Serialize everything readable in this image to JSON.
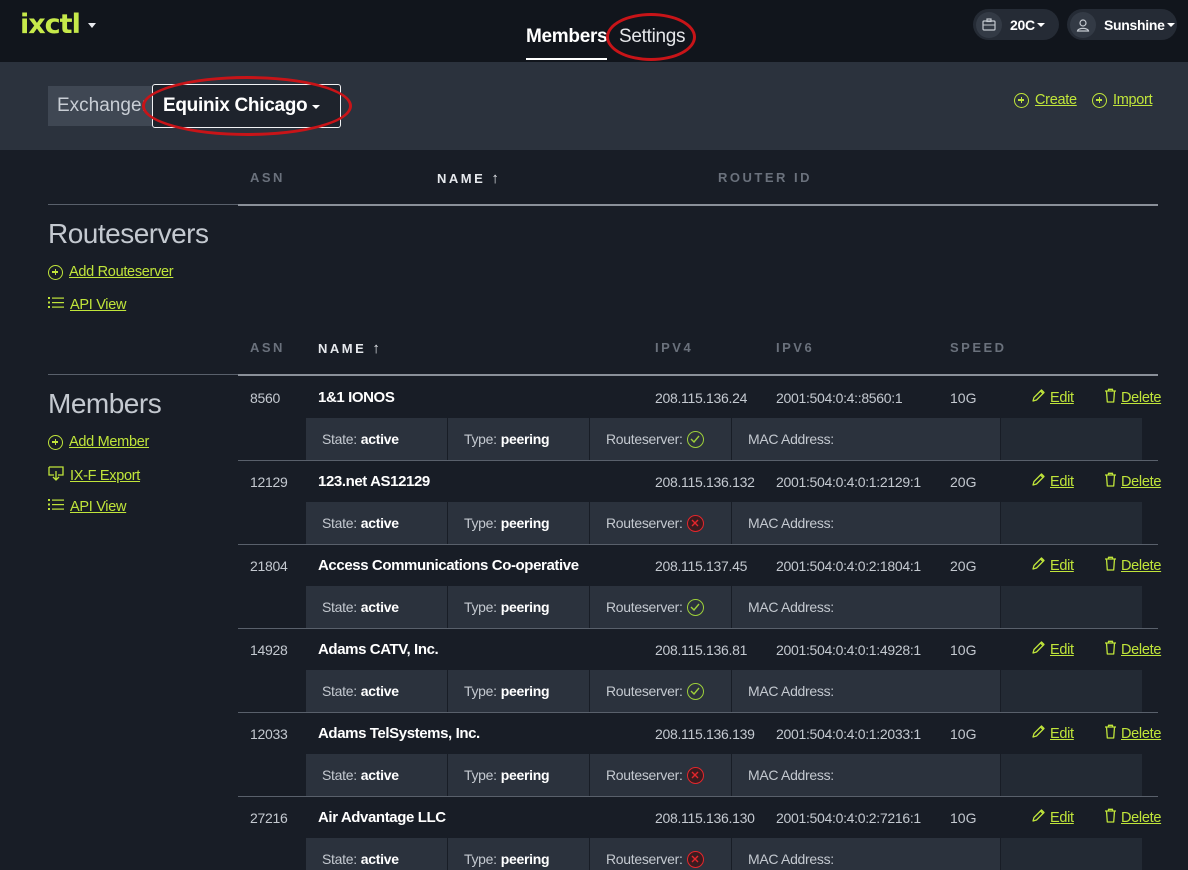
{
  "app": {
    "logo": "ixctl",
    "tabs": [
      {
        "label": "Members",
        "active": true
      },
      {
        "label": "Settings",
        "active": false
      }
    ],
    "org_label": "20C",
    "user_label": "Sunshine"
  },
  "exchange": {
    "label": "Exchange:",
    "selected": "Equinix Chicago",
    "create_label": "Create",
    "import_label": "Import"
  },
  "routeservers": {
    "title": "Routeservers",
    "add_label": "Add Routeserver",
    "api_label": "API View",
    "columns": [
      "ASN",
      "NAME",
      "ROUTER ID"
    ]
  },
  "members": {
    "title": "Members",
    "add_label": "Add Member",
    "export_label": "IX-F Export",
    "api_label": "API View",
    "columns": [
      "ASN",
      "NAME",
      "IPV4",
      "IPV6",
      "SPEED"
    ],
    "edit_label": "Edit",
    "delete_label": "Delete",
    "state_label": "State:",
    "type_label": "Type:",
    "rs_label": "Routeserver:",
    "mac_label": "MAC Address:",
    "rows": [
      {
        "asn": "8560",
        "name": "1&1 IONOS",
        "ipv4": "208.115.136.24",
        "ipv6": "2001:504:0:4::8560:1",
        "speed": "10G",
        "state": "active",
        "type": "peering",
        "routeserver": true
      },
      {
        "asn": "12129",
        "name": "123.net AS12129",
        "ipv4": "208.115.136.132",
        "ipv6": "2001:504:0:4:0:1:2129:1",
        "speed": "20G",
        "state": "active",
        "type": "peering",
        "routeserver": false
      },
      {
        "asn": "21804",
        "name": "Access Communications Co-operative",
        "ipv4": "208.115.137.45",
        "ipv6": "2001:504:0:4:0:2:1804:1",
        "speed": "20G",
        "state": "active",
        "type": "peering",
        "routeserver": true
      },
      {
        "asn": "14928",
        "name": "Adams CATV, Inc.",
        "ipv4": "208.115.136.81",
        "ipv6": "2001:504:0:4:0:1:4928:1",
        "speed": "10G",
        "state": "active",
        "type": "peering",
        "routeserver": true
      },
      {
        "asn": "12033",
        "name": "Adams TelSystems, Inc.",
        "ipv4": "208.115.136.139",
        "ipv6": "2001:504:0:4:0:1:2033:1",
        "speed": "10G",
        "state": "active",
        "type": "peering",
        "routeserver": false
      },
      {
        "asn": "27216",
        "name": "Air Advantage LLC",
        "ipv4": "208.115.136.130",
        "ipv6": "2001:504:0:4:0:2:7216:1",
        "speed": "10G",
        "state": "active",
        "type": "peering",
        "routeserver": false
      }
    ]
  },
  "colors": {
    "accent": "#c0e53a",
    "highlight_oval": "#c81418",
    "ok": "#9dcf3a",
    "error": "#e4262c"
  }
}
